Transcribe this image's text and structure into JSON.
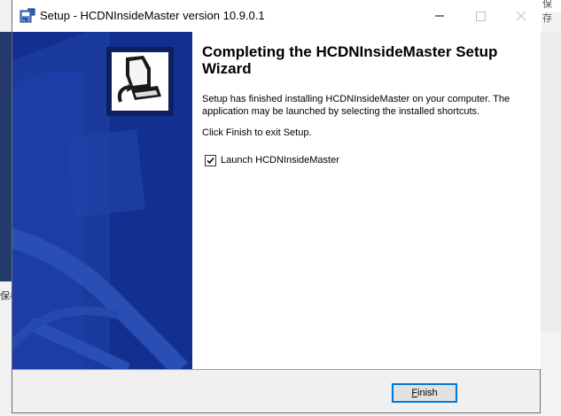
{
  "window": {
    "title": "Setup - HCDNInsideMaster version 10.9.0.1",
    "controls": {
      "minimize": "minimize-icon",
      "maximize": "maximize-icon",
      "close": "close-icon"
    }
  },
  "wizard": {
    "heading": "Completing the HCDNInsideMaster Setup Wizard",
    "paragraph1": "Setup has finished installing HCDNInsideMaster on your computer. The application may be launched by selecting the installed shortcuts.",
    "paragraph2": "Click Finish to exit Setup.",
    "launch_checkbox": {
      "label": "Launch HCDNInsideMaster",
      "checked": true
    }
  },
  "buttons": {
    "finish_mnemonic": "F",
    "finish_rest": "inish"
  },
  "background": {
    "right_text": "保存",
    "left_text": "保析"
  },
  "colors": {
    "banner": "#12308f",
    "accent": "#0078d7"
  }
}
